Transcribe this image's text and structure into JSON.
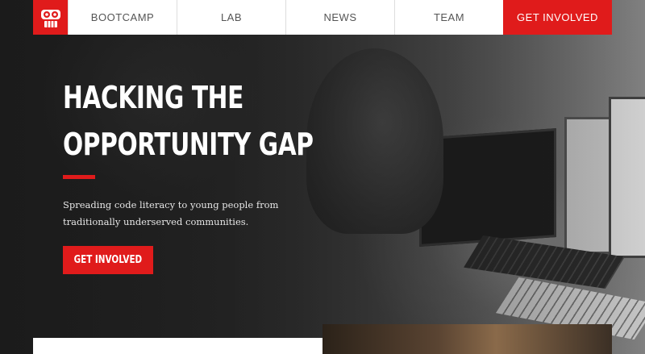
{
  "nav": {
    "logo_icon": "robot-logo-icon",
    "items": [
      {
        "label": "BOOTCAMP"
      },
      {
        "label": "LAB"
      },
      {
        "label": "NEWS"
      },
      {
        "label": "TEAM"
      }
    ],
    "cta_label": "GET INVOLVED"
  },
  "hero": {
    "headline_line1": "HACKING THE",
    "headline_line2": "OPPORTUNITY GAP",
    "subtext": "Spreading code literacy to young people from traditionally underserved communities.",
    "button_label": "GET INVOLVED"
  },
  "colors": {
    "accent": "#e01b1b",
    "nav_bg": "#ffffff",
    "text_light": "#ffffff"
  }
}
